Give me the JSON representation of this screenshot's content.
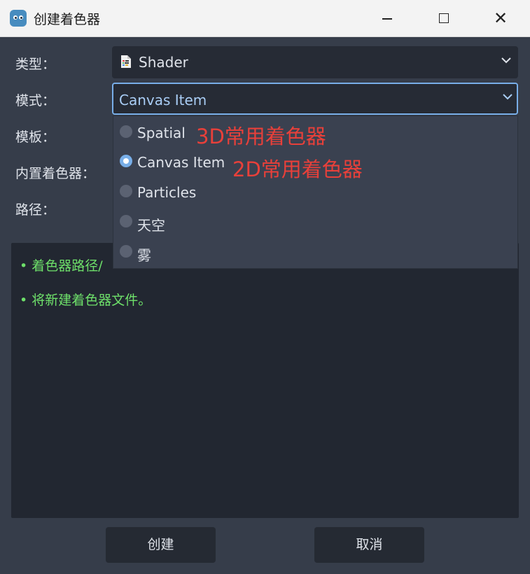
{
  "window": {
    "title": "创建着色器",
    "minimize": "—",
    "close": "✕"
  },
  "form": {
    "type_label": "类型：",
    "type_value": "Shader",
    "mode_label": "模式：",
    "mode_value": "Canvas Item",
    "template_label": "模板：",
    "builtin_label": "内置着色器：",
    "path_label": "路径："
  },
  "dropdown": {
    "options": [
      {
        "label": "Spatial",
        "selected": false
      },
      {
        "label": "Canvas Item",
        "selected": true
      },
      {
        "label": "Particles",
        "selected": false
      },
      {
        "label": "天空",
        "selected": false
      },
      {
        "label": "雾",
        "selected": false
      }
    ]
  },
  "annotations": {
    "spatial_note": "3D常用着色器",
    "canvas_note": "2D常用着色器"
  },
  "info": {
    "line1": "• 着色器路径/",
    "line2": "• 将新建着色器文件。"
  },
  "buttons": {
    "create": "创建",
    "cancel": "取消"
  },
  "colors": {
    "accent": "#78aee8",
    "annotation": "#e8403a",
    "info_text": "#6ee06a"
  },
  "icons": [
    "godot-app-icon",
    "shader-file-icon",
    "chevron-down-icon",
    "radio-icon"
  ]
}
